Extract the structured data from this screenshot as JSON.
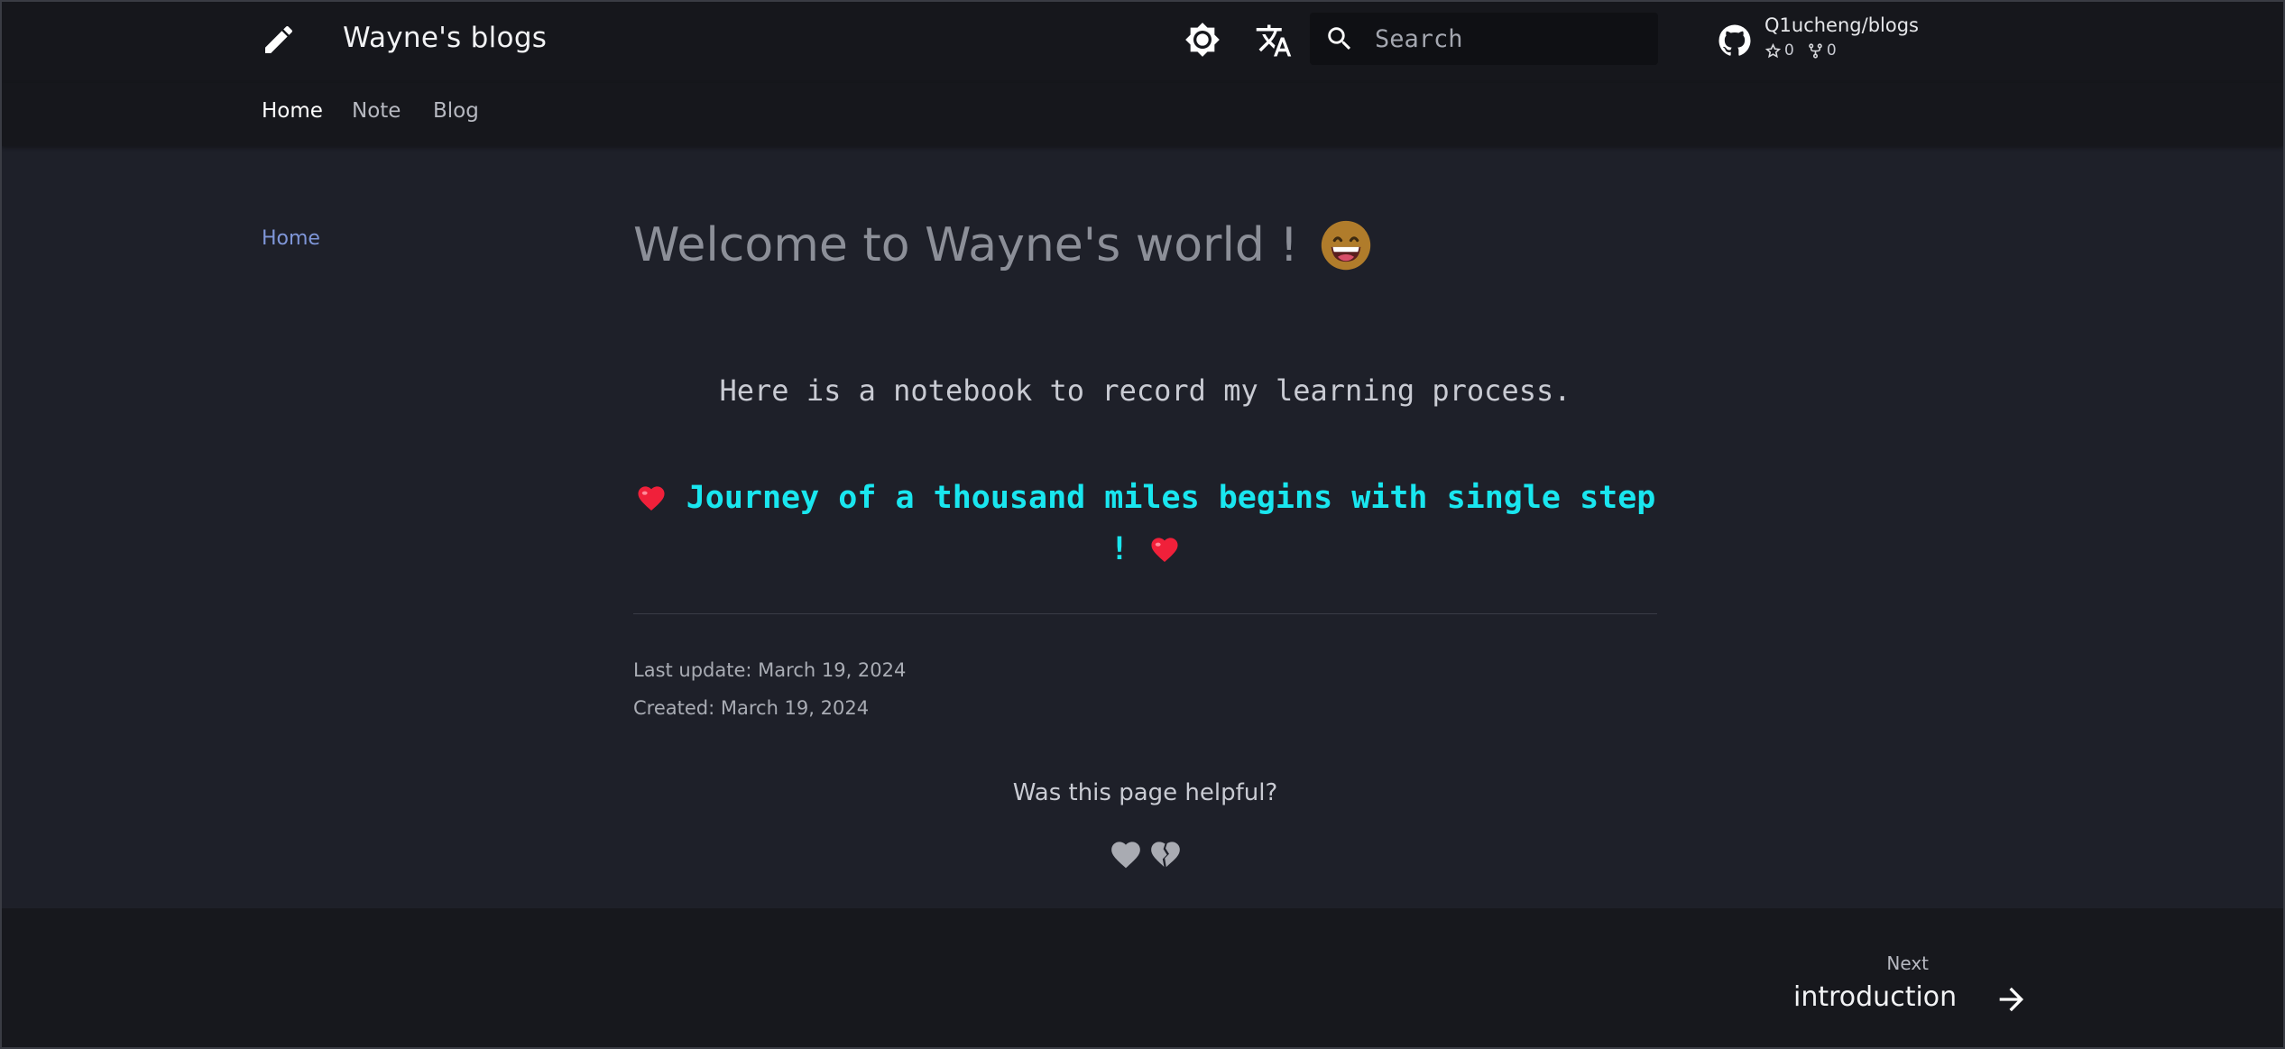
{
  "header": {
    "site_title": "Wayne's blogs",
    "logo_icon": "pencil-icon",
    "search": {
      "placeholder": "Search",
      "value": ""
    },
    "repo": {
      "name": "Q1ucheng/blogs",
      "stars": "0",
      "forks": "0"
    }
  },
  "tabs": [
    {
      "label": "Home",
      "active": true
    },
    {
      "label": "Note",
      "active": false
    },
    {
      "label": "Blog",
      "active": false
    }
  ],
  "nav": {
    "home_label": "Home"
  },
  "content": {
    "title": "Welcome to Wayne's world !",
    "intro": "Here is a notebook to record my learning process.",
    "quote": "Journey of a thousand miles begins with single step !",
    "last_update": "Last update: March 19, 2024",
    "created": "Created: March 19, 2024",
    "helpful_question": "Was this page helpful?"
  },
  "footer": {
    "next_label": "Next",
    "next_title": "introduction"
  },
  "colors": {
    "accent_link": "#7f96d8",
    "quote": "#19e6ef",
    "header_bg": "#16171c",
    "page_bg": "#1e2029"
  }
}
